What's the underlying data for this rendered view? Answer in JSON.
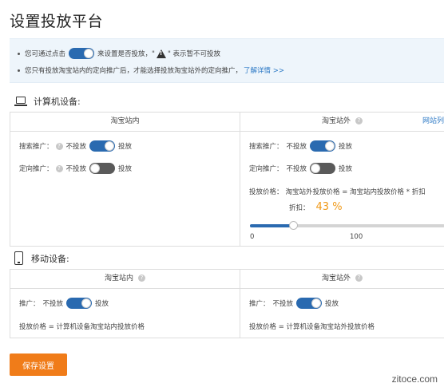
{
  "page": {
    "title": "设置投放平台"
  },
  "tips": {
    "line1_prefix": "您可通过点击",
    "line1_mid": "来设置是否投放，\"",
    "line1_suffix": "\" 表示暂不可投放",
    "line2_text": "您只有投放淘宝站内的定向推广后，才能选择投放淘宝站外的定向推广，",
    "line2_link": "了解详情 >>"
  },
  "computer": {
    "section_label": "计算机设备:",
    "inside": {
      "head": "淘宝站内",
      "search_label": "搜索推广：",
      "directed_label": "定向推广：",
      "off_label": "不投放",
      "on_label": "投放"
    },
    "outside": {
      "head": "淘宝站外",
      "head_link": "网站列",
      "search_label": "搜索推广：",
      "directed_label": "定向推广：",
      "off_label": "不投放",
      "on_label": "投放",
      "price_label": "投放价格：",
      "price_formula": "淘宝站外投放价格 = 淘宝站内投放价格 * 折扣",
      "discount_label": "折扣：",
      "discount_value": "43 %",
      "discount_fraction": 0.43,
      "slider_min": "0",
      "slider_max": "100"
    }
  },
  "mobile": {
    "section_label": "移动设备:",
    "inside": {
      "head": "淘宝站内",
      "promo_label": "推广：",
      "off_label": "不投放",
      "on_label": "投放",
      "price_text": "投放价格 =  计算机设备淘宝站内投放价格"
    },
    "outside": {
      "head": "淘宝站外",
      "promo_label": "推广：",
      "off_label": "不投放",
      "on_label": "投放",
      "price_text": "投放价格 =  计算机设备淘宝站外投放价格"
    }
  },
  "actions": {
    "save_label": "保存设置"
  },
  "watermark": "zitoce.com",
  "colors": {
    "accent": "#2a6ab0",
    "orange": "#f07c19",
    "percent": "#f09a1a",
    "tip_bg": "#eef5fb"
  }
}
